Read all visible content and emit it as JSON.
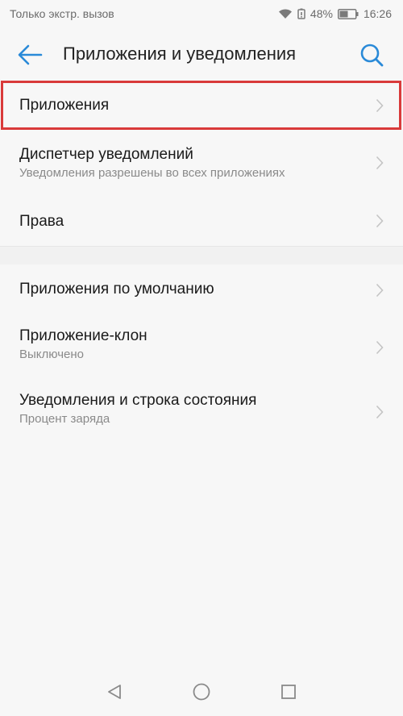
{
  "status_bar": {
    "carrier_text": "Только экстр. вызов",
    "battery_percent": "48%",
    "time": "16:26",
    "icons": [
      "wifi-icon",
      "battery-saver-icon",
      "battery-icon"
    ]
  },
  "header": {
    "title": "Приложения и уведомления",
    "back_icon": "arrow-left-icon",
    "search_icon": "search-icon"
  },
  "list": {
    "items": [
      {
        "title": "Приложения",
        "subtitle": ""
      },
      {
        "title": "Диспетчер уведомлений",
        "subtitle": "Уведомления разрешены во всех приложениях"
      },
      {
        "title": "Права",
        "subtitle": ""
      },
      {
        "title": "Приложения по умолчанию",
        "subtitle": ""
      },
      {
        "title": "Приложение-клон",
        "subtitle": "Выключено"
      },
      {
        "title": "Уведомления и строка состояния",
        "subtitle": "Процент заряда"
      }
    ]
  },
  "highlight": {
    "color": "#d93a3a"
  },
  "colors": {
    "accent": "#2a8ad8",
    "background": "#f7f7f7"
  },
  "nav_bar": {
    "icons": [
      "back-triangle-icon",
      "home-circle-icon",
      "recents-square-icon"
    ]
  }
}
